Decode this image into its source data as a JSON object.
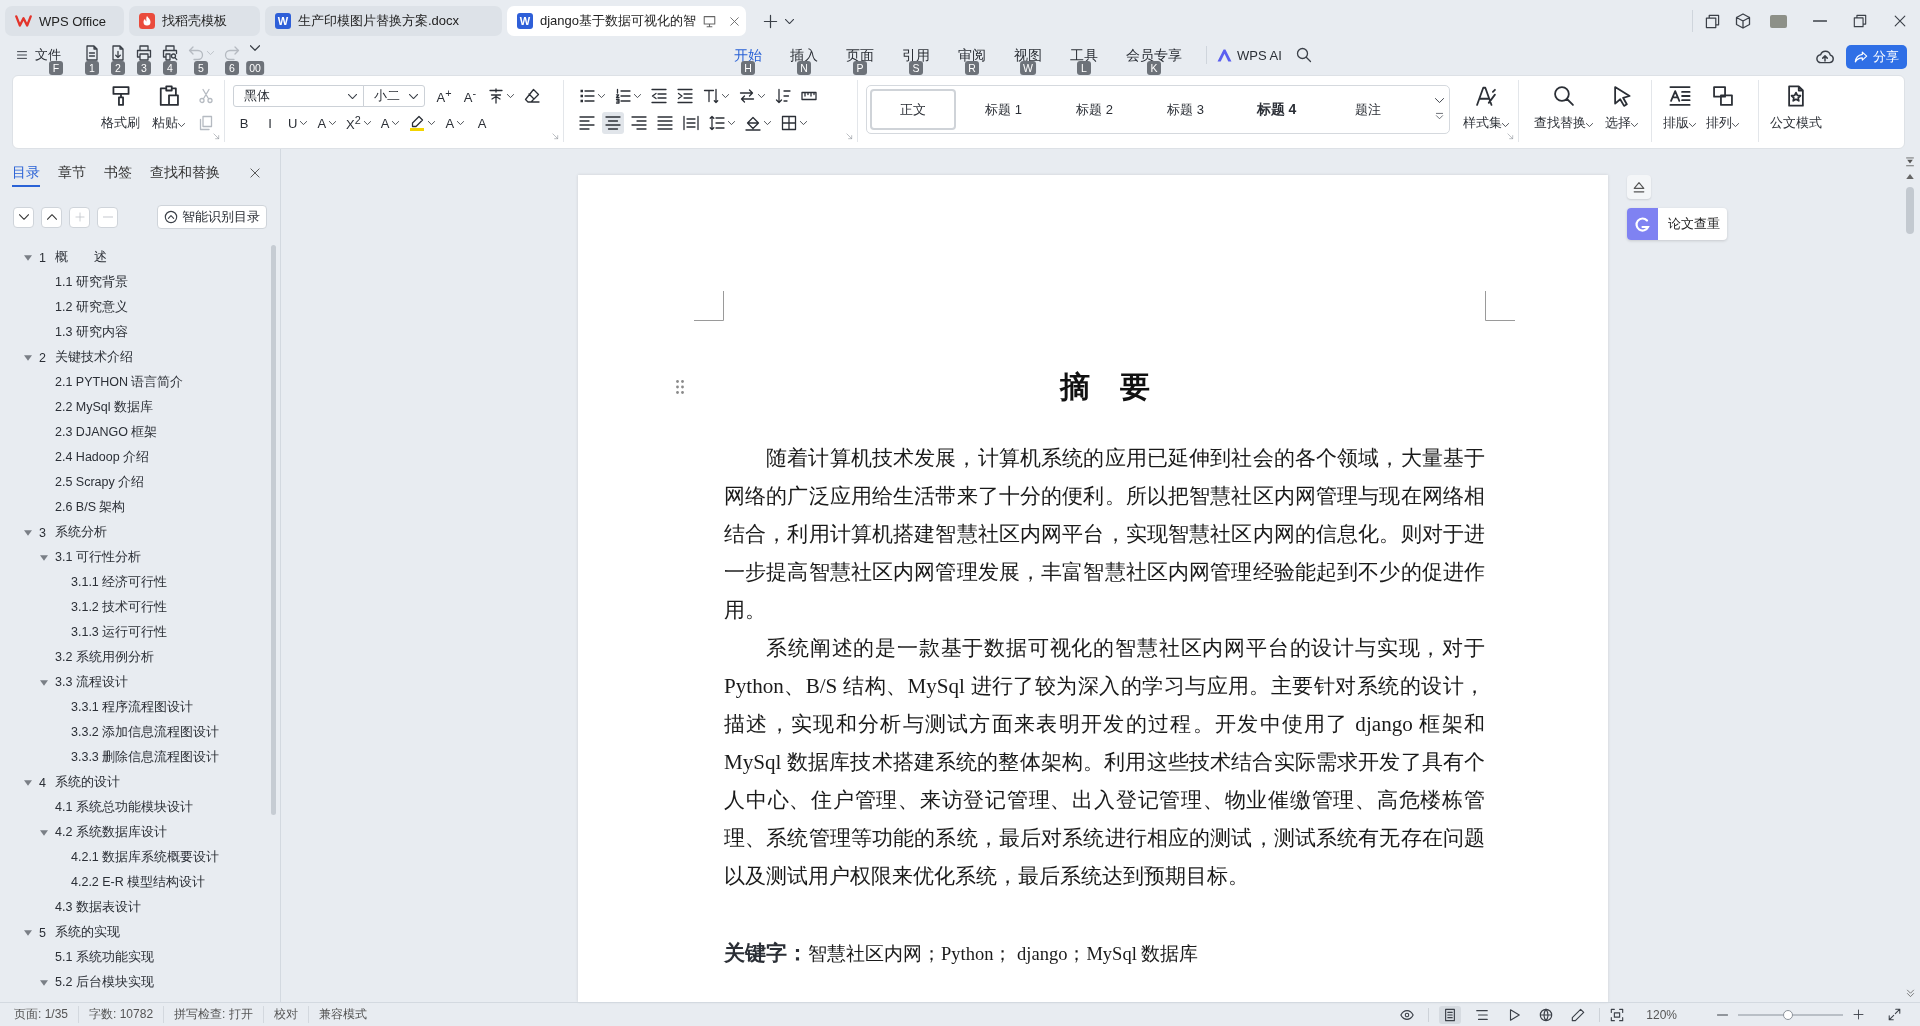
{
  "tab_bar": {
    "tabs": [
      {
        "label": "WPS Office",
        "kind": "home",
        "selected": false
      },
      {
        "label": "找稻壳模板",
        "kind": "templates",
        "selected": false
      },
      {
        "label": "生产印模图片替换方案.docx",
        "kind": "document",
        "badge": "W",
        "selected": false
      },
      {
        "label": "django基于数据可视化的智",
        "kind": "document",
        "badge": "W",
        "selected": true
      }
    ]
  },
  "menu_bar": {
    "file_menu": {
      "label": "文件",
      "key_tip": "F"
    },
    "quick_access": [
      {
        "kind": "save",
        "key_tip": "1",
        "disabled": false,
        "dropdown": false
      },
      {
        "kind": "export",
        "key_tip": "2",
        "disabled": false,
        "dropdown": false
      },
      {
        "kind": "print",
        "key_tip": "3",
        "disabled": false,
        "dropdown": false
      },
      {
        "kind": "print-preview",
        "key_tip": "4",
        "disabled": false,
        "dropdown": false
      },
      {
        "kind": "undo",
        "key_tip": "5",
        "disabled": true,
        "dropdown": true
      },
      {
        "kind": "redo",
        "key_tip": "6",
        "disabled": true,
        "dropdown": false
      },
      {
        "kind": "more",
        "key_tip": "00",
        "disabled": false,
        "dropdown": false
      }
    ],
    "ribbon_tabs": [
      {
        "label": "开始",
        "key_tip": "H",
        "selected": true
      },
      {
        "label": "插入",
        "key_tip": "N",
        "selected": false
      },
      {
        "label": "页面",
        "key_tip": "P",
        "selected": false
      },
      {
        "label": "引用",
        "key_tip": "S",
        "selected": false
      },
      {
        "label": "审阅",
        "key_tip": "R",
        "selected": false
      },
      {
        "label": "视图",
        "key_tip": "W",
        "selected": false
      },
      {
        "label": "工具",
        "key_tip": "L",
        "selected": false
      },
      {
        "label": "会员专享",
        "key_tip": "K",
        "selected": false
      }
    ],
    "ai_button": {
      "label": "WPS AI"
    },
    "share_button": {
      "label": "分享"
    }
  },
  "ribbon": {
    "clipboard": [
      {
        "kind": "format-painter",
        "label": "格式刷",
        "dropdown": false
      },
      {
        "kind": "paste",
        "label": "粘贴",
        "dropdown": true
      }
    ],
    "clipboard_small": [
      {
        "kind": "cut",
        "disabled": true
      },
      {
        "kind": "copy",
        "disabled": true
      }
    ],
    "font": {
      "family": "黑体",
      "size": "小二"
    },
    "font_row_1": [
      {
        "kind": "grow",
        "glyph": "A$^{+}$",
        "dropdown": false
      },
      {
        "kind": "shrink",
        "glyph": "A$^{-}$",
        "dropdown": false
      },
      {
        "kind": "pinyin",
        "dropdown": true
      },
      {
        "kind": "clear",
        "dropdown": false
      }
    ],
    "font_row_2": [
      {
        "kind": "bold",
        "glyph": "B",
        "dropdown": false
      },
      {
        "kind": "italic",
        "glyph": "I",
        "dropdown": false
      },
      {
        "kind": "underline",
        "glyph": "U",
        "dropdown": true
      },
      {
        "kind": "strike",
        "glyph": "A",
        "dropdown": true
      },
      {
        "kind": "superscript",
        "glyph": "X$^{2}$",
        "dropdown": true
      },
      {
        "kind": "effect",
        "glyph": "A",
        "dropdown": true
      },
      {
        "kind": "highlight",
        "dropdown": true
      },
      {
        "kind": "font-color",
        "glyph": "A",
        "dropdown": true
      },
      {
        "kind": "shading",
        "glyph": "A",
        "dropdown": false
      }
    ],
    "paragraph_row_1": [
      {
        "kind": "bullets",
        "dropdown": true
      },
      {
        "kind": "numbering",
        "dropdown": true
      },
      {
        "kind": "outdent",
        "dropdown": false
      },
      {
        "kind": "indent",
        "dropdown": false
      },
      {
        "kind": "text-direction",
        "dropdown": true
      },
      {
        "kind": "swap",
        "dropdown": true
      },
      {
        "kind": "sort",
        "dropdown": false
      },
      {
        "kind": "ruler",
        "dropdown": false
      }
    ],
    "alignment": [
      {
        "kind": "align-left",
        "selected": false
      },
      {
        "kind": "align-center",
        "selected": true
      },
      {
        "kind": "align-right",
        "selected": false
      },
      {
        "kind": "justify",
        "selected": false
      },
      {
        "kind": "distribute",
        "selected": false
      }
    ],
    "paragraph_tools": [
      {
        "kind": "line-spacing",
        "dropdown": true
      },
      {
        "kind": "fill",
        "dropdown": true
      },
      {
        "kind": "borders",
        "dropdown": true
      }
    ],
    "styles": [
      {
        "label": "正文",
        "selected": true,
        "bold": false
      },
      {
        "label": "标题 1",
        "selected": false,
        "bold": false
      },
      {
        "label": "标题 2",
        "selected": false,
        "bold": false
      },
      {
        "label": "标题 3",
        "selected": false,
        "bold": false
      },
      {
        "label": "标题 4",
        "selected": false,
        "bold": true
      },
      {
        "label": "题注",
        "selected": false,
        "bold": false
      }
    ],
    "style_set": {
      "kind": "style-set",
      "label": "样式集",
      "dropdown": true
    },
    "tool_groups": [
      [
        {
          "kind": "find-replace",
          "label": "查找替换",
          "dropdown": true
        },
        {
          "kind": "select",
          "label": "选择",
          "dropdown": true
        }
      ],
      [
        {
          "kind": "typesetting",
          "label": "排版",
          "dropdown": true
        },
        {
          "kind": "arrange",
          "label": "排列",
          "dropdown": true
        }
      ],
      [
        {
          "kind": "official-mode",
          "label": "公文模式",
          "dropdown": false
        }
      ]
    ]
  },
  "nav_panel": {
    "tabs": [
      {
        "label": "目录",
        "selected": true
      },
      {
        "label": "章节",
        "selected": false
      },
      {
        "label": "书签",
        "selected": false
      },
      {
        "label": "查找和替换",
        "selected": false
      }
    ],
    "outline_buttons": [
      {
        "kind": "down",
        "disabled": false
      },
      {
        "kind": "up",
        "disabled": false
      },
      {
        "kind": "plus",
        "disabled": true
      },
      {
        "kind": "minus",
        "disabled": true
      }
    ],
    "smart_button": {
      "label": "智能识别目录"
    },
    "outline": [
      {
        "number": "1",
        "label": "概　　述",
        "expanded": true,
        "children": [
          {
            "label": "1.1 研究背景"
          },
          {
            "label": "1.2 研究意义"
          },
          {
            "label": "1.3 研究内容"
          }
        ]
      },
      {
        "number": "2",
        "label": "关键技术介绍",
        "expanded": true,
        "children": [
          {
            "label": "2.1 PYTHON 语言简介"
          },
          {
            "label": "2.2 MySql 数据库"
          },
          {
            "label": "2.3 DJANGO 框架"
          },
          {
            "label": "2.4 Hadoop 介绍"
          },
          {
            "label": "2.5 Scrapy 介绍"
          },
          {
            "label": "2.6 B/S 架构"
          }
        ]
      },
      {
        "number": "3",
        "label": "系统分析",
        "expanded": true,
        "children": [
          {
            "label": "3.1 可行性分析",
            "expanded": true,
            "children": [
              {
                "label": "3.1.1 经济可行性"
              },
              {
                "label": "3.1.2 技术可行性"
              },
              {
                "label": "3.1.3 运行可行性"
              }
            ]
          },
          {
            "label": "3.2 系统用例分析"
          },
          {
            "label": "3.3 流程设计",
            "expanded": true,
            "children": [
              {
                "label": "3.3.1 程序流程图设计"
              },
              {
                "label": "3.3.2 添加信息流程图设计"
              },
              {
                "label": "3.3.3 删除信息流程图设计"
              }
            ]
          }
        ]
      },
      {
        "number": "4",
        "label": "系统的设计",
        "expanded": true,
        "children": [
          {
            "label": "4.1 系统总功能模块设计"
          },
          {
            "label": "4.2 系统数据库设计",
            "expanded": true,
            "children": [
              {
                "label": "4.2.1 数据库系统概要设计"
              },
              {
                "label": "4.2.2 E-R 模型结构设计"
              }
            ]
          },
          {
            "label": "4.3 数据表设计"
          }
        ]
      },
      {
        "number": "5",
        "label": "系统的实现",
        "expanded": true,
        "children": [
          {
            "label": "5.1 系统功能实现"
          },
          {
            "label": "5.2 后台模块实现",
            "expanded": true
          }
        ]
      }
    ]
  },
  "document": {
    "title": "摘　要",
    "paragraphs": [
      "随着计算机技术发展，计算机系统的应用已延伸到社会的各个领域，大量基于网络的广泛应用给生活带来了十分的便利。所以把智慧社区内网管理与现在网络相结合，利用计算机搭建智慧社区内网平台，实现智慧社区内网的信息化。则对于进一步提高智慧社区内网管理发展，丰富智慧社区内网管理经验能起到不少的促进作用。",
      "系统阐述的是一款基于数据可视化的智慧社区内网平台的设计与实现，对于Python、B/S 结构、MySql 进行了较为深入的学习与应用。主要针对系统的设计，描述，实现和分析与测试方面来表明开发的过程。开发中使用了 django 框架和MySql 数据库技术搭建系统的整体架构。利用这些技术结合实际需求开发了具有个人中心、住户管理、来访登记管理、出入登记管理、物业催缴管理、高危楼栋管理、系统管理等功能的系统，最后对系统进行相应的测试，测试系统有无存在问题以及测试用户权限来优化系统，最后系统达到预期目标。"
    ],
    "keywords": {
      "label": "关键字：",
      "text": "智慧社区内网；Python； django；MySql 数据库"
    }
  },
  "side_tools": {
    "plagiarism_button": {
      "label": "论文查重"
    }
  },
  "status_bar": {
    "items": [
      "页面: 1/35",
      "字数: 10782",
      "拼写检查: 打开",
      "校对",
      "兼容模式"
    ],
    "view_modes": [
      {
        "kind": "eye",
        "selected": false
      },
      {
        "kind": "page",
        "selected": true
      },
      {
        "kind": "outline",
        "selected": false
      },
      {
        "kind": "play",
        "selected": false
      },
      {
        "kind": "globe",
        "selected": false
      },
      {
        "kind": "pen",
        "selected": false
      }
    ],
    "zoom": "120%",
    "zoom_slider": {
      "level": 0.48
    }
  }
}
